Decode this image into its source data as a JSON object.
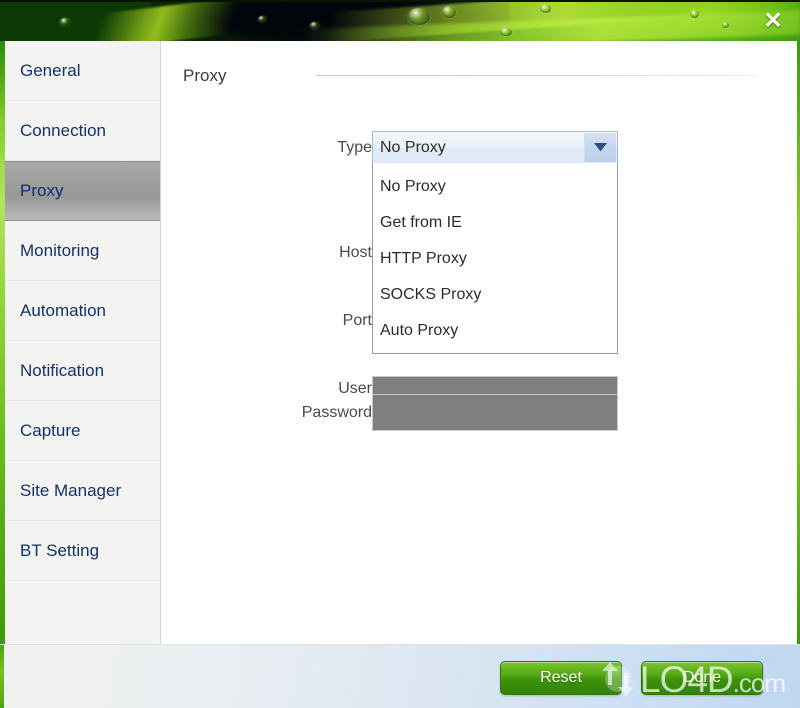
{
  "window": {
    "close_label": "✕",
    "accent_green": "#6cbd1e",
    "header_image": "green-leaf-with-water-droplets"
  },
  "sidebar": {
    "items": [
      {
        "label": "General",
        "selected": false
      },
      {
        "label": "Connection",
        "selected": false
      },
      {
        "label": "Proxy",
        "selected": true
      },
      {
        "label": "Monitoring",
        "selected": false
      },
      {
        "label": "Automation",
        "selected": false
      },
      {
        "label": "Notification",
        "selected": false
      },
      {
        "label": "Capture",
        "selected": false
      },
      {
        "label": "Site Manager",
        "selected": false
      },
      {
        "label": "BT Setting",
        "selected": false
      }
    ]
  },
  "main": {
    "section_title": "Proxy",
    "fields": {
      "type_label": "Type",
      "type_value": "No Proxy",
      "host_label": "Host",
      "host_value": "",
      "port_label": "Port",
      "port_value": "",
      "user_label": "User",
      "user_value": "",
      "password_label": "Password",
      "password_value": ""
    },
    "type_options": [
      "No Proxy",
      "Get from IE",
      "HTTP Proxy",
      "SOCKS Proxy",
      "Auto Proxy"
    ]
  },
  "footer": {
    "reset_label": "Reset",
    "done_label": "Done"
  },
  "watermark": {
    "text_main": "LO4D",
    "text_suffix": ".com"
  }
}
